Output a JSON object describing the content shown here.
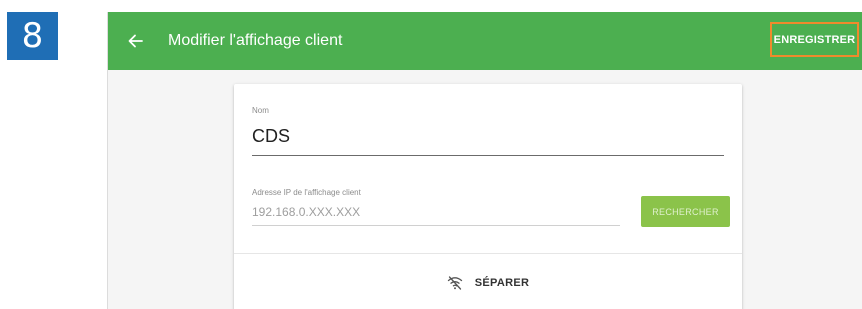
{
  "step_number": "8",
  "toolbar": {
    "back_icon": "arrow-left-icon",
    "title": "Modifier l'affichage client",
    "save_label": "ENREGISTRER",
    "highlight_color": "#f08a2c",
    "color": "#4caf50"
  },
  "form": {
    "name_label": "Nom",
    "name_value": "CDS",
    "ip_label": "Adresse IP de l'affichage client",
    "ip_placeholder": "192.168.0.XXX.XXX",
    "search_label": "RECHERCHER",
    "separate_icon": "wifi-off-icon",
    "separate_label": "SÉPARER"
  }
}
